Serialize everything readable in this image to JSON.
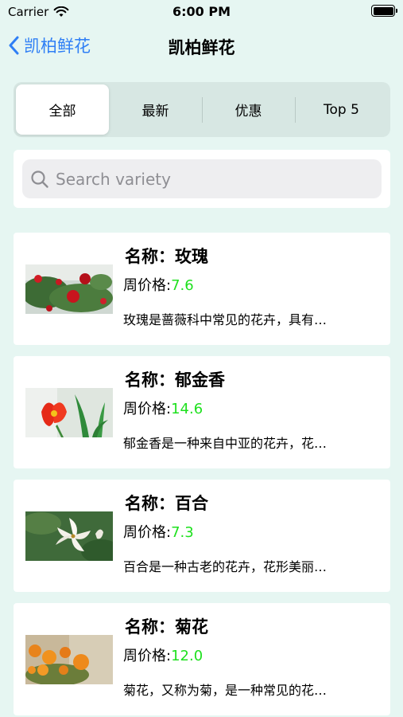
{
  "status_bar": {
    "carrier": "Carrier",
    "time": "6:00 PM"
  },
  "nav": {
    "back_label": "凯柏鲜花",
    "title": "凯柏鲜花"
  },
  "tabs": [
    {
      "label": "全部",
      "selected": true
    },
    {
      "label": "最新",
      "selected": false
    },
    {
      "label": "优惠",
      "selected": false
    },
    {
      "label": "Top 5",
      "selected": false
    }
  ],
  "search": {
    "placeholder": "Search variety",
    "value": ""
  },
  "flowers": [
    {
      "name": "名称：玫瑰",
      "price_label": "周价格:",
      "price": "7.6",
      "desc": "玫瑰是蔷薇科中常见的花卉，具有…"
    },
    {
      "name": "名称：郁金香",
      "price_label": "周价格:",
      "price": "14.6",
      "desc": "郁金香是一种来自中亚的花卉，花…"
    },
    {
      "name": "名称：百合",
      "price_label": "周价格:",
      "price": "7.3",
      "desc": "百合是一种古老的花卉，花形美丽…"
    },
    {
      "name": "名称：菊花",
      "price_label": "周价格:",
      "price": "12.0",
      "desc": "菊花，又称为菊，是一种常见的花…"
    }
  ],
  "colors": {
    "accent": "#2f7ff5",
    "price": "#1ee01e",
    "background": "#e6f6f2"
  }
}
